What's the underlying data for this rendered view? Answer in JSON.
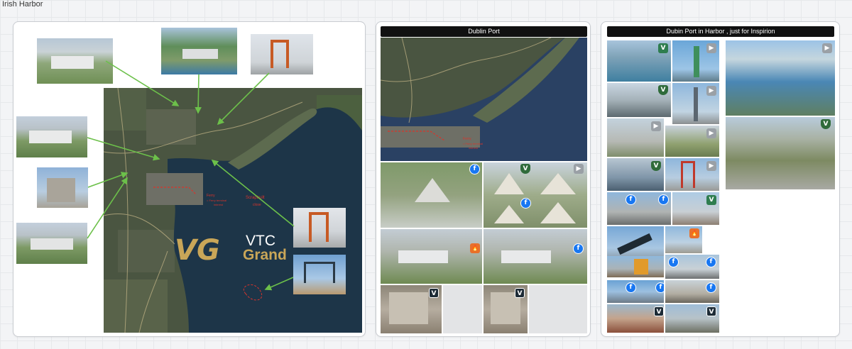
{
  "board": {
    "title": "Irish Harbor"
  },
  "frames": {
    "dublin_port": {
      "header": "Dublin Port"
    },
    "inspiration": {
      "header": "Dubin Port in Harbor , just for Inspirion"
    }
  },
  "map": {
    "brand_name_top": "VTC",
    "brand_name_bottom": "Grand",
    "brand_logo": "VG",
    "annotations": {
      "ferry": "Ferry",
      "ferry_terminal": "= Ferry terminal",
      "ferry_terminal_2": "interest",
      "scrapbuilt": "Scrapbuilt",
      "scrapbuilt_2": "close"
    }
  },
  "zoom_map_annotations": {
    "ferry": "Ferry",
    "ferry_terminal": "= Ferry terminal",
    "ferry_terminal_2": "interest"
  },
  "icons": {
    "facebook": "f",
    "play": "▶",
    "vtc": "V",
    "flame": "🔥"
  },
  "colors": {
    "arrow": "#6cc04a",
    "annotation": "#d9342b",
    "water": "#1d3548",
    "brand_gold": "#c9a658"
  }
}
